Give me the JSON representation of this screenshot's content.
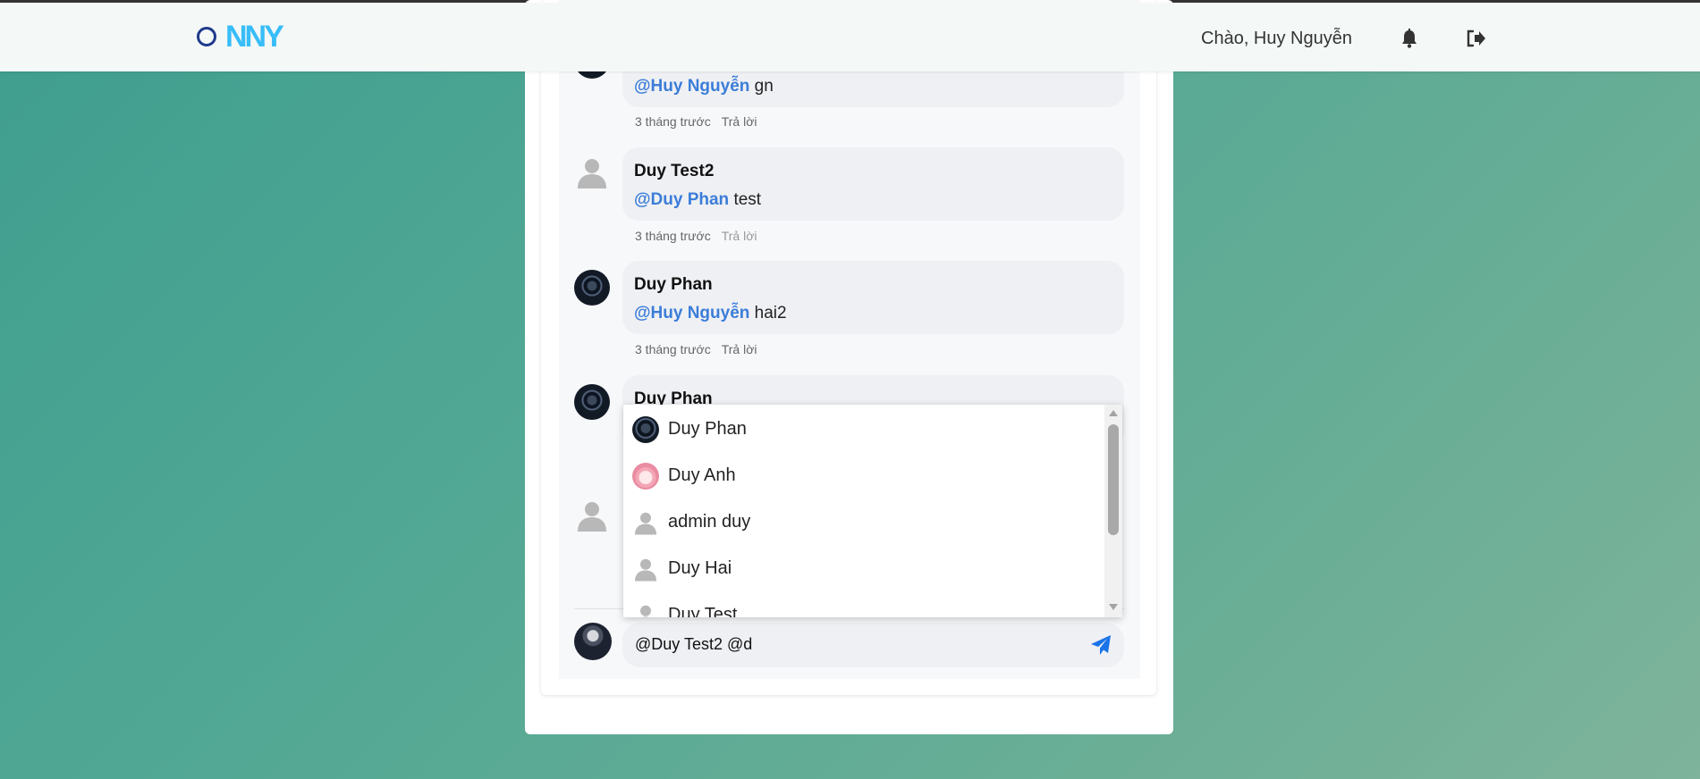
{
  "header": {
    "logo_text": "NNY",
    "greeting": "Chào, Huy Nguyễn"
  },
  "icons": {
    "notifications": "bell-icon",
    "logout": "sign-out-icon",
    "send": "paper-plane-icon"
  },
  "comments": [
    {
      "author": "",
      "mention": "@Huy Nguyễn",
      "text": "gn",
      "time": "3 tháng trước",
      "reply": "Trả lời"
    },
    {
      "author": "Duy Test2",
      "mention": "@Duy Phan",
      "text": "test",
      "time": "3 tháng trước",
      "reply": "Trả lời"
    },
    {
      "author": "Duy Phan",
      "mention": "@Huy Nguyễn",
      "text": "hai2",
      "time": "3 tháng trước",
      "reply": "Trả lời"
    },
    {
      "author": "Duy Phan"
    }
  ],
  "mention_dropdown": {
    "items": [
      {
        "name": "Duy Phan"
      },
      {
        "name": "Duy Anh"
      },
      {
        "name": "admin duy"
      },
      {
        "name": "Duy Hai"
      },
      {
        "name": "Duy Test"
      }
    ]
  },
  "comment_input": {
    "value": "@Duy Test2 @d"
  },
  "colors": {
    "mention": "#3b7dd8",
    "send_icon": "#1a73e8",
    "background_start": "#3f9e8f",
    "background_end": "#7fb39b"
  }
}
